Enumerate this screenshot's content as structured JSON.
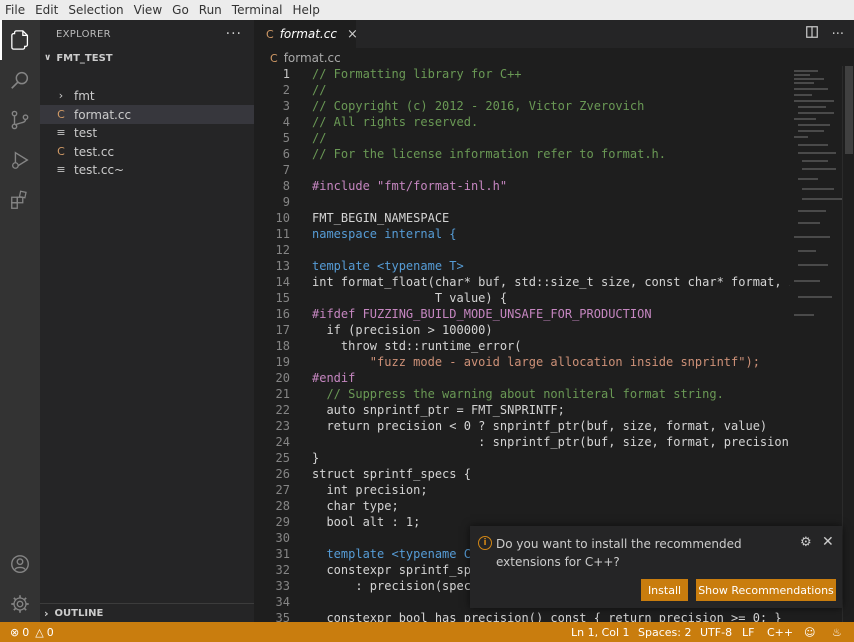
{
  "menu": [
    "File",
    "Edit",
    "Selection",
    "View",
    "Go",
    "Run",
    "Terminal",
    "Help"
  ],
  "activity": [
    "explorer-icon",
    "search-icon",
    "source-control-icon",
    "run-debug-icon",
    "extensions-icon",
    "account-icon",
    "settings-gear-icon"
  ],
  "explorer": {
    "title": "EXPLORER",
    "more": "···",
    "folder": "FMT_TEST",
    "items": [
      {
        "label": "fmt",
        "kind": "folder"
      },
      {
        "label": "format.cc",
        "kind": "c-file"
      },
      {
        "label": "test",
        "kind": "text-file"
      },
      {
        "label": "test.cc",
        "kind": "c-file"
      },
      {
        "label": "test.cc~",
        "kind": "text-file"
      }
    ],
    "outline": "OUTLINE"
  },
  "tab": {
    "label": "format.cc",
    "close": "×"
  },
  "breadcrumb": "format.cc",
  "code": [
    {
      "n": "1",
      "t": "// Formatting library for C++"
    },
    {
      "n": "2",
      "t": "//"
    },
    {
      "n": "3",
      "t": "// Copyright (c) 2012 - 2016, Victor Zverovich"
    },
    {
      "n": "4",
      "t": "// All rights reserved."
    },
    {
      "n": "5",
      "t": "//"
    },
    {
      "n": "6",
      "t": "// For the license information refer to format.h."
    },
    {
      "n": "7",
      "t": ""
    },
    {
      "n": "8",
      "t": "#include \"fmt/format-inl.h\""
    },
    {
      "n": "9",
      "t": ""
    },
    {
      "n": "10",
      "t": "FMT_BEGIN_NAMESPACE"
    },
    {
      "n": "11",
      "t": "namespace internal {"
    },
    {
      "n": "12",
      "t": ""
    },
    {
      "n": "13",
      "t": "template <typename T>"
    },
    {
      "n": "14",
      "t": "int format_float(char* buf, std::size_t size, const char* format, in"
    },
    {
      "n": "15",
      "t": "                 T value) {"
    },
    {
      "n": "16",
      "t": "#ifdef FUZZING_BUILD_MODE_UNSAFE_FOR_PRODUCTION"
    },
    {
      "n": "17",
      "t": "  if (precision > 100000)"
    },
    {
      "n": "18",
      "t": "    throw std::runtime_error("
    },
    {
      "n": "19",
      "t": "        \"fuzz mode - avoid large allocation inside snprintf\");"
    },
    {
      "n": "20",
      "t": "#endif"
    },
    {
      "n": "21",
      "t": "  // Suppress the warning about nonliteral format string."
    },
    {
      "n": "22",
      "t": "  auto snprintf_ptr = FMT_SNPRINTF;"
    },
    {
      "n": "23",
      "t": "  return precision < 0 ? snprintf_ptr(buf, size, format, value)"
    },
    {
      "n": "24",
      "t": "                       : snprintf_ptr(buf, size, format, precision,"
    },
    {
      "n": "25",
      "t": "}"
    },
    {
      "n": "26",
      "t": "struct sprintf_specs {"
    },
    {
      "n": "27",
      "t": "  int precision;"
    },
    {
      "n": "28",
      "t": "  char type;"
    },
    {
      "n": "29",
      "t": "  bool alt : 1;"
    },
    {
      "n": "30",
      "t": ""
    },
    {
      "n": "31",
      "t": "  template <typename Ch"
    },
    {
      "n": "32",
      "t": "  constexpr sprintf_spe"
    },
    {
      "n": "33",
      "t": "      : precision(specs"
    },
    {
      "n": "34",
      "t": ""
    },
    {
      "n": "35",
      "t": "  constexpr bool has_precision() const { return precision >= 0; }"
    }
  ],
  "notification": {
    "message": "Do you want to install the recommended extensions for C++?",
    "install": "Install",
    "show_recommendations": "Show Recommendations"
  },
  "status": {
    "errors": "0",
    "warnings": "0",
    "position": "Ln 1, Col 1",
    "spaces": "Spaces: 2",
    "encoding": "UTF-8",
    "eol": "LF",
    "language": "C++"
  }
}
